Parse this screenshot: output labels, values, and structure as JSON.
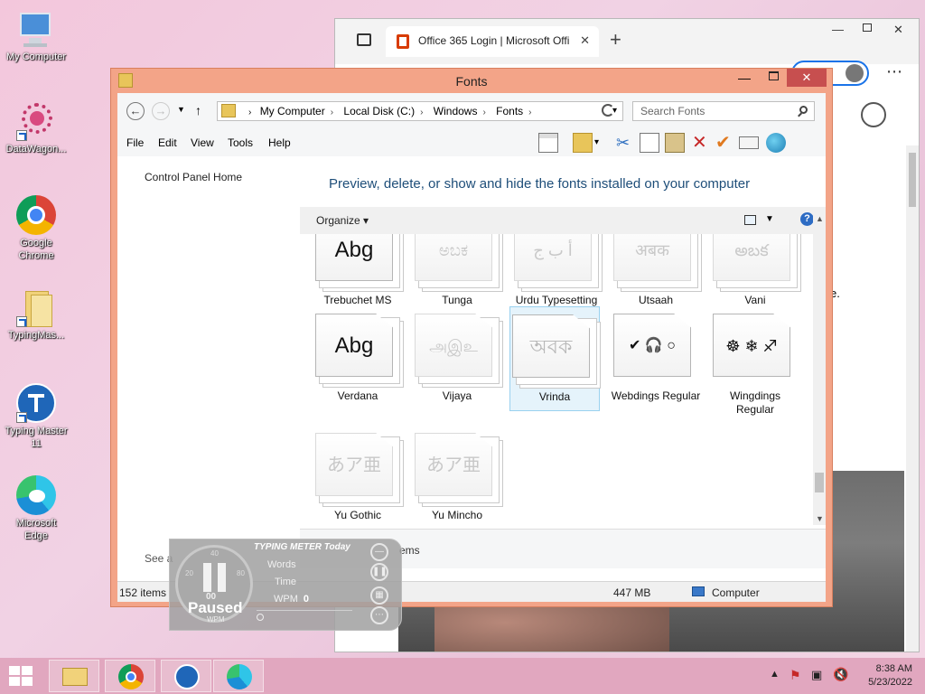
{
  "desktop": {
    "icons": [
      {
        "label": "My Computer",
        "icon": "computer-icon"
      },
      {
        "label": "DataWagon...",
        "icon": "datawagon-icon"
      },
      {
        "label": "Google Chrome",
        "icon": "chrome-icon"
      },
      {
        "label": "TypingMas...",
        "icon": "folder-icon"
      },
      {
        "label": "Typing Master 11",
        "icon": "typing-master-icon"
      },
      {
        "label": "Microsoft Edge",
        "icon": "edge-icon"
      }
    ]
  },
  "browser": {
    "tab_title": "Office 365 Login | Microsoft Offi",
    "fragment": "e."
  },
  "explorer": {
    "title": "Fonts",
    "address": {
      "segments": [
        "My Computer",
        "Local Disk (C:)",
        "Windows",
        "Fonts"
      ]
    },
    "search_placeholder": "Search Fonts",
    "menu": [
      "File",
      "Edit",
      "View",
      "Tools",
      "Help"
    ],
    "sidebar": {
      "control_panel_home": "Control Panel Home",
      "see_also": "See a"
    },
    "headline": "Preview, delete, or show and hide the fonts installed on your computer",
    "organize": "Organize",
    "fonts": [
      {
        "name": "Trebuchet MS",
        "sample": "Abg",
        "hidden": false
      },
      {
        "name": "Tunga",
        "sample": "ಅಬಕ",
        "hidden": true
      },
      {
        "name": "Urdu Typesetting",
        "sample": "أ ب ج",
        "hidden": true
      },
      {
        "name": "Utsaah",
        "sample": "अबक",
        "hidden": true
      },
      {
        "name": "Vani",
        "sample": "అబక",
        "hidden": true
      },
      {
        "name": "Verdana",
        "sample": "Abg",
        "hidden": false
      },
      {
        "name": "Vijaya",
        "sample": "அஇஉ",
        "hidden": true
      },
      {
        "name": "Vrinda",
        "sample": "অবক",
        "hidden": true,
        "selected": true
      },
      {
        "name": "Webdings Regular",
        "sample": "✔ 🎧 ○",
        "hidden": false
      },
      {
        "name": "Wingdings Regular",
        "sample": "☸ ❄ ♐",
        "hidden": false
      },
      {
        "name": "Yu Gothic",
        "sample": "あア亜",
        "hidden": true
      },
      {
        "name": "Yu Mincho",
        "sample": "あア亜",
        "hidden": true
      }
    ],
    "details_text": "ems",
    "status": {
      "items": "152 items",
      "size": "447 MB",
      "location": "Computer"
    }
  },
  "typing_meter": {
    "title": "TYPING METER Today",
    "gauge_ticks": [
      "40",
      "20",
      "80"
    ],
    "gauge_value": "00",
    "state": "Paused",
    "unit": "WPM",
    "words_label": "Words",
    "time_label": "Time",
    "wpm_label": "WPM",
    "wpm_value": "0"
  },
  "taskbar": {
    "time": "8:38 AM",
    "date": "5/23/2022"
  },
  "colors": {
    "explorer_frame": "#f3a488",
    "headline": "#1e4e79",
    "taskbar": "#e1a7bf"
  }
}
